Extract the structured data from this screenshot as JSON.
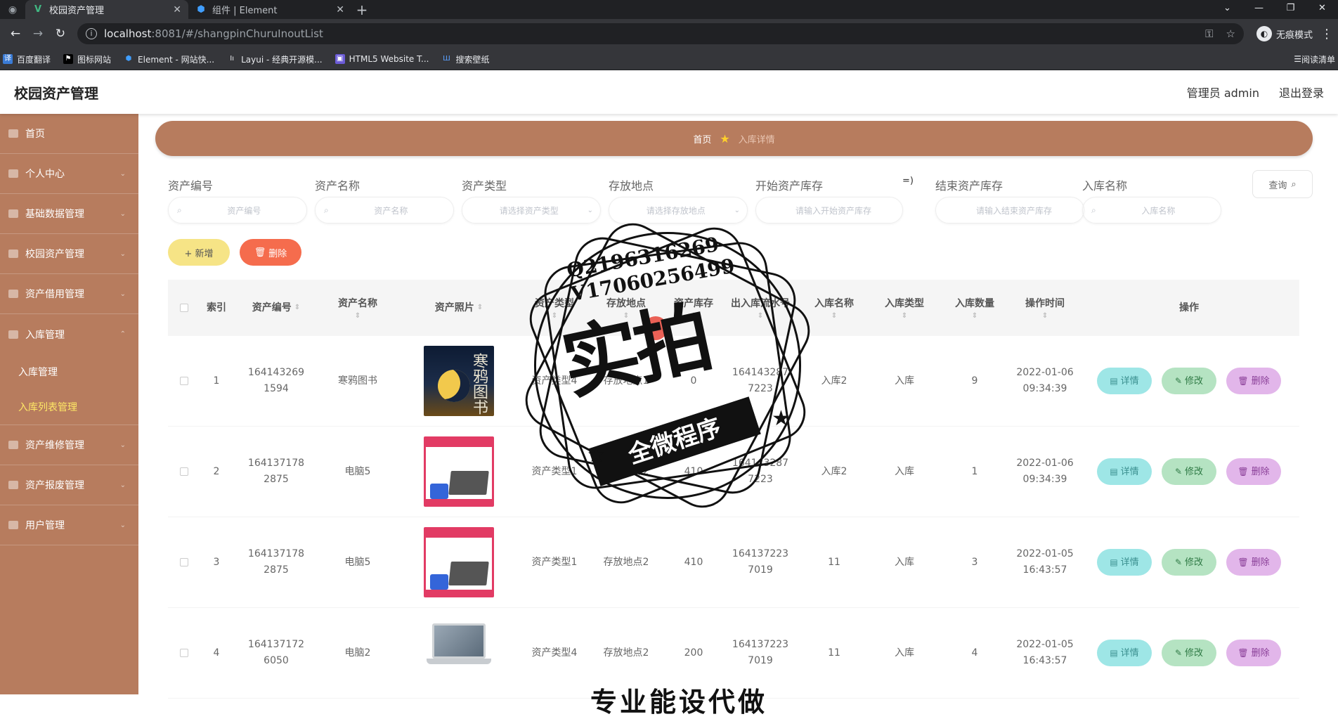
{
  "browser": {
    "tabs": [
      {
        "title": "校园资产管理",
        "active": true,
        "icon": "vue-icon"
      },
      {
        "title": "组件 | Element",
        "active": false,
        "icon": "element-icon"
      }
    ],
    "new_tab": "+",
    "url_host": "localhost",
    "url_path": ":8081/#/shangpinChuruInoutList",
    "incognito_label": "无痕模式",
    "bookmarks": [
      "百度翻译",
      "图标网站",
      "Element - 网站快...",
      "Layui - 经典开源模...",
      "HTML5 Website T...",
      "搜索壁纸"
    ],
    "reading_list": "阅读清单"
  },
  "header": {
    "title": "校园资产管理",
    "user": "管理员 admin",
    "logout": "退出登录"
  },
  "sidebar": {
    "items": [
      {
        "label": "首页"
      },
      {
        "label": "个人中心"
      },
      {
        "label": "基础数据管理"
      },
      {
        "label": "校园资产管理"
      },
      {
        "label": "资产借用管理"
      },
      {
        "label": "入库管理"
      },
      {
        "label": "资产维修管理"
      },
      {
        "label": "资产报废管理"
      },
      {
        "label": "用户管理"
      }
    ],
    "sub_items": [
      {
        "label": "入库管理",
        "active": false
      },
      {
        "label": "入库列表管理",
        "active": true
      }
    ]
  },
  "breadcrumb": {
    "home": "首页",
    "current": "入库详情"
  },
  "filters": {
    "labels": [
      "资产编号",
      "资产名称",
      "资产类型",
      "存放地点",
      "开始资产库存",
      "结束资产库存",
      "入库名称"
    ],
    "placeholders": [
      "资产编号",
      "资产名称",
      "请选择资产类型",
      "请选择存放地点",
      "请输入开始资产库存",
      "请输入结束资产库存",
      "入库名称"
    ],
    "range_separator": "=)",
    "search_button": "查询"
  },
  "actions": {
    "add": "+ 新增",
    "delete": "删除"
  },
  "table": {
    "headers": [
      "索引",
      "资产编号",
      "资产名称",
      "资产照片",
      "资产类型",
      "存放地点",
      "资产库存",
      "出入库流水号",
      "入库名称",
      "入库类型",
      "入库数量",
      "操作时间",
      "操作"
    ],
    "rows": [
      {
        "index": "1",
        "asset_no": "1641432691594",
        "name": "寒鸦图书",
        "image": "book",
        "type": "资产类型4",
        "location": "存放地点1",
        "stock": "0",
        "flow_no": "1641432877223",
        "in_name": "入库2",
        "in_type": "入库",
        "qty": "9",
        "time": "2022-01-06 09:34:39"
      },
      {
        "index": "2",
        "asset_no": "1641371782875",
        "name": "电脑5",
        "image": "laptop-ad",
        "type": "资产类型1",
        "location": "存放地点2",
        "stock": "410",
        "flow_no": "1641432877223",
        "in_name": "入库2",
        "in_type": "入库",
        "qty": "1",
        "time": "2022-01-06 09:34:39"
      },
      {
        "index": "3",
        "asset_no": "1641371782875",
        "name": "电脑5",
        "image": "laptop-ad",
        "type": "资产类型1",
        "location": "存放地点2",
        "stock": "410",
        "flow_no": "1641372237019",
        "in_name": "11",
        "in_type": "入库",
        "qty": "3",
        "time": "2022-01-05 16:43:57"
      },
      {
        "index": "4",
        "asset_no": "1641371726050",
        "name": "电脑2",
        "image": "laptop",
        "type": "资产类型4",
        "location": "存放地点2",
        "stock": "200",
        "flow_no": "1641372237019",
        "in_name": "11",
        "in_type": "入库",
        "qty": "4",
        "time": "2022-01-05 16:43:57"
      }
    ],
    "op_labels": {
      "detail": "详情",
      "edit": "修改",
      "delete": "删除"
    }
  },
  "watermark": {
    "qq": "Q2196316269",
    "vx": "V17060256499",
    "big": "实拍",
    "ribbon": "全微程序",
    "bottom": "专业能设代做"
  },
  "colors": {
    "sidebar": "#b77c5e",
    "active_sub": "#ffe866",
    "delete": "#f56c4d",
    "add": "#f6e486"
  }
}
